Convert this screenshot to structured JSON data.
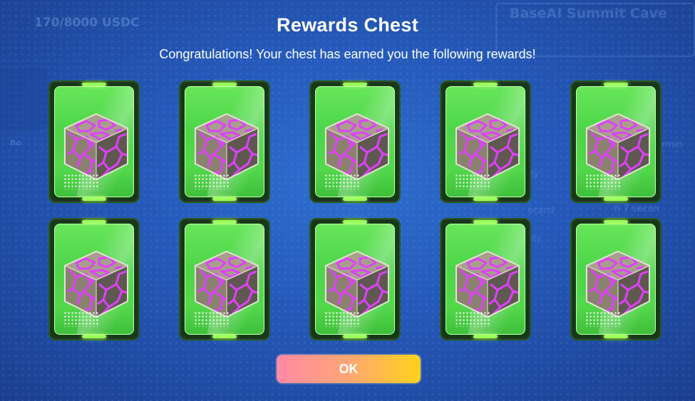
{
  "background": {
    "balance": "170/8000 USDC",
    "title": "BaseAI Summit Cave",
    "left_label": "Bo",
    "right_label_1": "rmin",
    "right_label_2": "n 7 secon",
    "right_label_3": "ity",
    "right_label_4": "ecand",
    "right_label_5": "lity"
  },
  "dialog": {
    "title": "Rewards Chest",
    "subtitle": "Congratulations! Your chest has earned you the following rewards!",
    "ok_label": "OK"
  },
  "rewards": [
    {
      "item": "crystal-cube"
    },
    {
      "item": "crystal-cube"
    },
    {
      "item": "crystal-cube"
    },
    {
      "item": "crystal-cube"
    },
    {
      "item": "crystal-cube"
    },
    {
      "item": "crystal-cube"
    },
    {
      "item": "crystal-cube"
    },
    {
      "item": "crystal-cube"
    },
    {
      "item": "crystal-cube"
    },
    {
      "item": "crystal-cube"
    }
  ],
  "colors": {
    "card_green": "#4dd54a",
    "cube_vein": "#e040ff",
    "ok_gradient_start": "#ff8aa6",
    "ok_gradient_end": "#ffd21a"
  }
}
